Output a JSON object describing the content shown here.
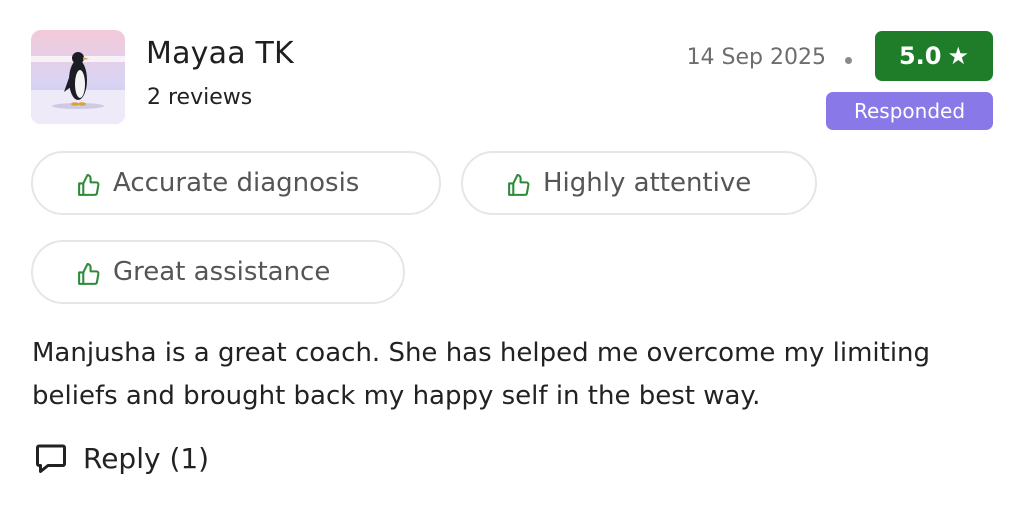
{
  "reviewer": {
    "name": "Mayaa TK",
    "reviews_count": "2 reviews"
  },
  "meta": {
    "date": "14 Sep 2025",
    "rating": "5.0",
    "rating_star": "★",
    "status_badge": "Responded"
  },
  "tags": [
    {
      "label": "Accurate diagnosis",
      "icon": "thumbs-up-icon"
    },
    {
      "label": "Highly attentive",
      "icon": "thumbs-up-icon"
    },
    {
      "label": "Great assistance",
      "icon": "thumbs-up-icon"
    }
  ],
  "review": {
    "text": "Manjusha is a great coach. She has helped me overcome my limiting beliefs and brought back my happy self in the best way."
  },
  "actions": {
    "reply_label": "Reply (1)",
    "reply_icon": "chat-bubble-icon"
  },
  "colors": {
    "rating_badge": "#1f7d2a",
    "responded_badge": "#8878e8",
    "thumb_icon": "#2e8b3a"
  }
}
